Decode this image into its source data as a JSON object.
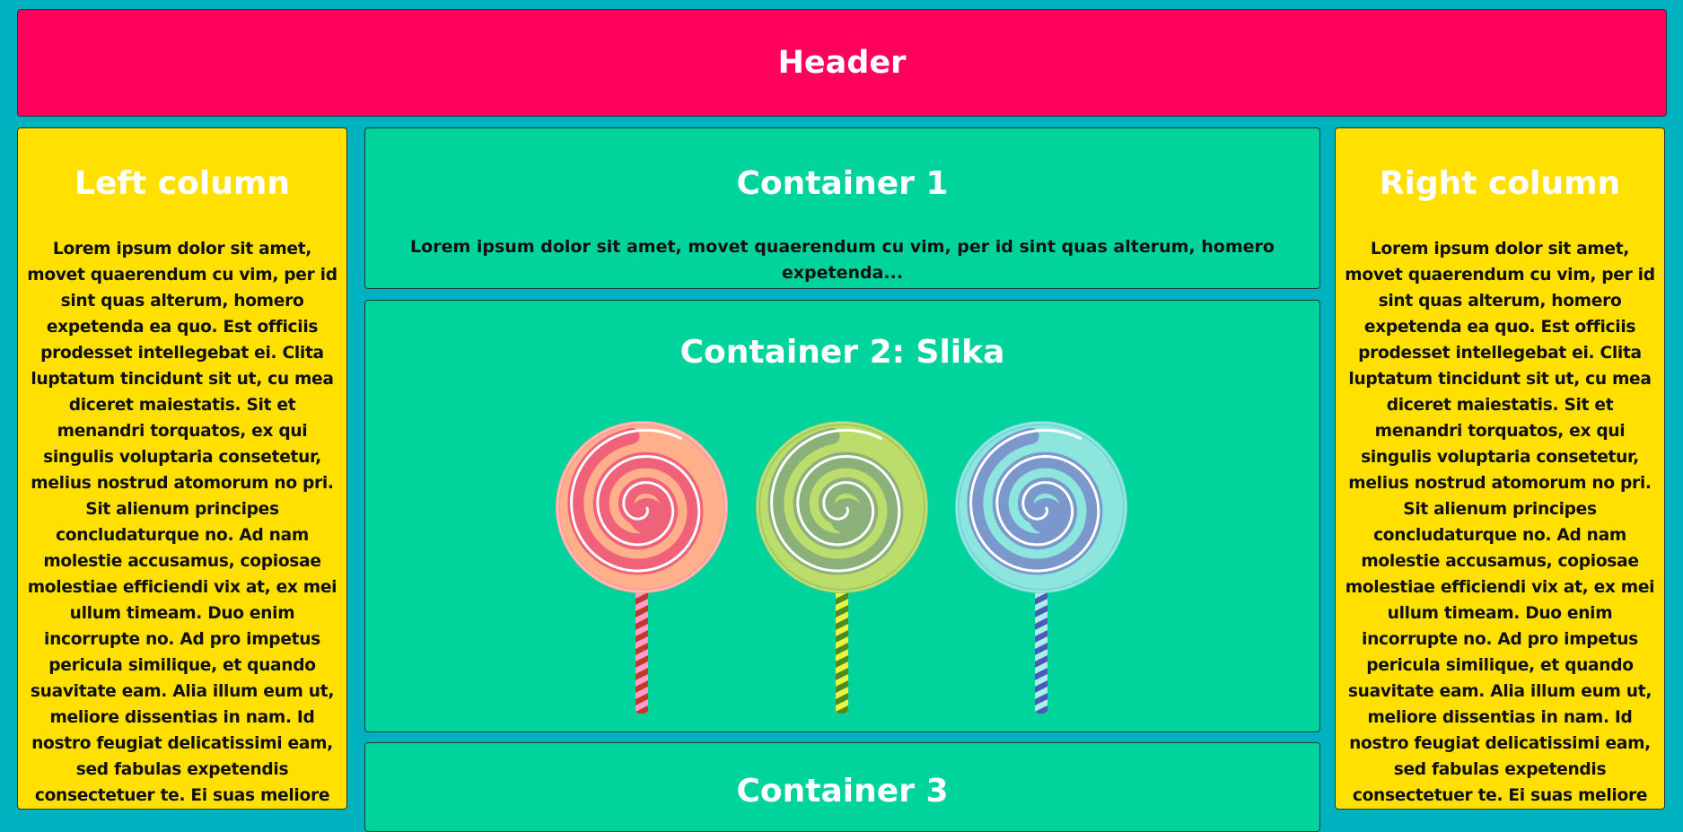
{
  "header": {
    "title": "Header"
  },
  "left_column": {
    "title": "Left column",
    "text": "Lorem ipsum dolor sit amet, movet quaerendum cu vim, per id sint quas alterum, homero expetenda ea quo. Est officiis prodesset intellegebat ei. Clita luptatum tincidunt sit ut, cu mea diceret maiestatis. Sit et menandri torquatos, ex qui singulis voluptaria consetetur, melius nostrud atomorum no pri. Sit alienum principes concludaturque no. Ad nam molestie accusamus, copiosae molestiae efficiendi vix at, ex mei ullum timeam. Duo enim incorrupte no. Ad pro impetus pericula similique, et quando suavitate eam. Alia illum eum ut, meliore dissentias in nam. Id nostro feugiat delicatissimi eam, sed fabulas expetendis consectetuer te. Ei suas meliore mea, te lucilius evertitur vim."
  },
  "right_column": {
    "title": "Right column",
    "text": "Lorem ipsum dolor sit amet, movet quaerendum cu vim, per id sint quas alterum, homero expetenda ea quo. Est officiis prodesset intellegebat ei. Clita luptatum tincidunt sit ut, cu mea diceret maiestatis. Sit et menandri torquatos, ex qui singulis voluptaria consetetur, melius nostrud atomorum no pri. Sit alienum principes concludaturque no. Ad nam molestie accusamus, copiosae molestiae efficiendi vix at, ex mei ullum timeam. Duo enim incorrupte no. Ad pro impetus pericula similique, et quando suavitate eam. Alia illum eum ut, meliore dissentias in nam. Id nostro feugiat delicatissimi eam, sed fabulas expetendis consectetuer te. Ei suas meliore mea, te lucilius evertitur vim."
  },
  "container_1": {
    "title": "Container 1",
    "text": "Lorem ipsum dolor sit amet, movet quaerendum cu vim, per id sint quas alterum, homero expetenda..."
  },
  "container_2": {
    "title": "Container 2: Slika",
    "image": {
      "icon": "lollipops-illustration",
      "lollipops": [
        {
          "name": "pink",
          "outer": "#ffb08a",
          "swirl": "#f0627a",
          "ring": "#ff9f97",
          "stick_a": "#c0392b",
          "stick_b": "#ff9ecb"
        },
        {
          "name": "green",
          "outer": "#bcdc6c",
          "swirl": "#8cb07a",
          "ring": "#9fcc55",
          "stick_a": "#4e8a1e",
          "stick_b": "#e8f542"
        },
        {
          "name": "blue",
          "outer": "#8de6de",
          "swirl": "#7b98cc",
          "ring": "#6fd8d8",
          "stick_a": "#5057b8",
          "stick_b": "#a8f0ea"
        }
      ]
    }
  },
  "container_3": {
    "title": "Container 3"
  },
  "colors": {
    "page_background": "#00b2c0",
    "header": "#ff005c",
    "side_columns": "#ffe000",
    "containers": "#00d49c",
    "heading_text": "#ffffff",
    "body_text": "#111111"
  }
}
